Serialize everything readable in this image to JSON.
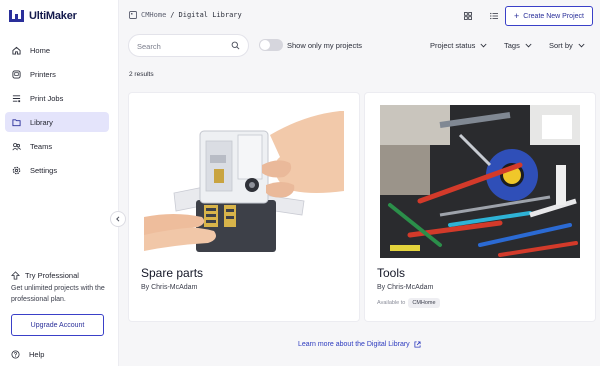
{
  "app": {
    "brand": "UltiMaker"
  },
  "sidebar": {
    "items": [
      {
        "label": "Home",
        "icon": "home-icon"
      },
      {
        "label": "Printers",
        "icon": "printer-icon"
      },
      {
        "label": "Print Jobs",
        "icon": "print-jobs-icon"
      },
      {
        "label": "Library",
        "icon": "library-icon",
        "active": true
      },
      {
        "label": "Teams",
        "icon": "teams-icon"
      },
      {
        "label": "Settings",
        "icon": "gear-icon"
      }
    ],
    "promo": {
      "title": "Try Professional",
      "text": "Get unlimited projects with the professional plan.",
      "button": "Upgrade Account"
    },
    "help": "Help"
  },
  "header": {
    "breadcrumb_root": "CMHome",
    "breadcrumb_separator": "/",
    "breadcrumb_current": "Digital Library",
    "create_button": "Create New Project"
  },
  "filters": {
    "search_placeholder": "Search",
    "toggle_label": "Show only my projects",
    "toggle_on": false,
    "project_status": "Project status",
    "tags": "Tags",
    "sort_by": "Sort by"
  },
  "results_count": "2 results",
  "projects": [
    {
      "title": "Spare parts",
      "owner": "By Chris-McAdam"
    },
    {
      "title": "Tools",
      "owner": "By Chris-McAdam",
      "available_label": "Available to",
      "available_chip": "CMHome"
    }
  ],
  "footer_link": "Learn more about the Digital Library",
  "colors": {
    "accent": "#3a40c8",
    "active_bg": "#e4e4fb",
    "brand": "#141a4d",
    "link": "#2d3bbf"
  }
}
